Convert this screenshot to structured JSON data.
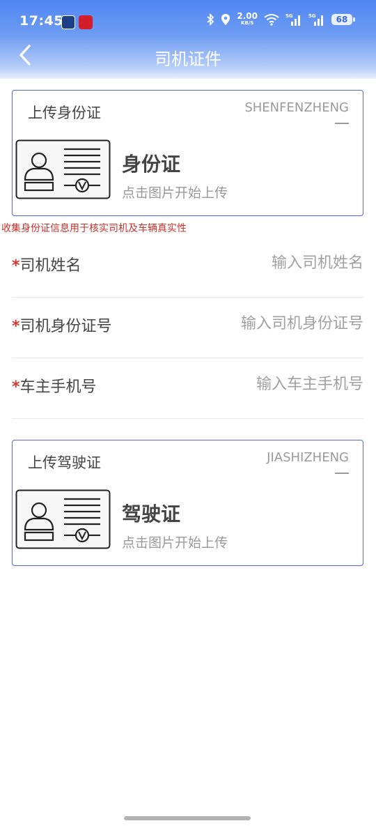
{
  "status_bar": {
    "time": "17:45",
    "speed_value": "2.00",
    "speed_unit": "KB/S",
    "signal1": "5G",
    "signal2": "5G",
    "battery": "68"
  },
  "nav": {
    "title": "司机证件"
  },
  "id_card": {
    "head": "上传身份证",
    "eng": "SHENFENZHENG",
    "big": "身份证",
    "tap": "点击图片开始上传"
  },
  "notice": "收集身份证信息用于核实司机及车辆真实性",
  "fields": [
    {
      "star": "*",
      "label": "司机姓名",
      "placeholder": "输入司机姓名"
    },
    {
      "star": "*",
      "label": "司机身份证号",
      "placeholder": "输入司机身份证号"
    },
    {
      "star": "*",
      "label": "车主手机号",
      "placeholder": "输入车主手机号"
    }
  ],
  "license_card": {
    "head": "上传驾驶证",
    "eng": "JIASHIZHENG",
    "big": "驾驶证",
    "tap": "点击图片开始上传"
  },
  "colors": {
    "accent": "#4f86f0",
    "card_border": "#5a6ad0",
    "required": "#d2392f",
    "notice": "#c9312b"
  }
}
